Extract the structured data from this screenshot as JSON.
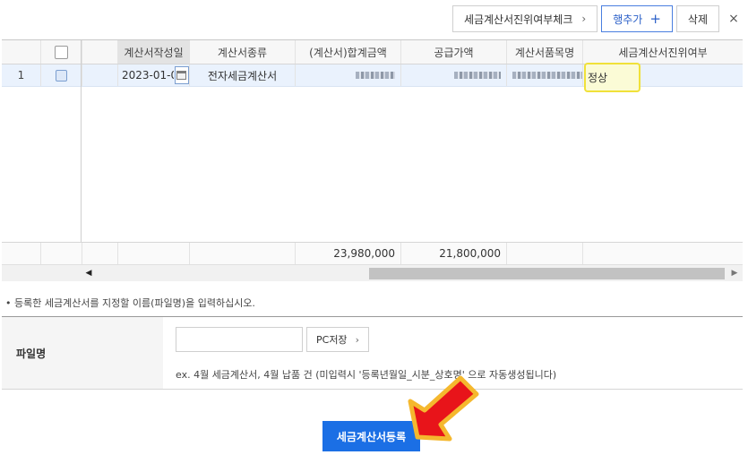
{
  "toolbar": {
    "verify_label": "세금계산서진위여부체크",
    "add_row_label": "행추가",
    "delete_label": "삭제",
    "close_symbol": "×"
  },
  "grid": {
    "columns": [
      "계산서작성일",
      "계산서종류",
      "(계산서)합계금액",
      "공급가액",
      "계산서품목명",
      "세금계산서진위여부"
    ],
    "rows": [
      {
        "num": "1",
        "date": "2023-01-06",
        "type": "전자세금계산서",
        "status": "정상"
      }
    ],
    "totals": {
      "total_amount": "23,980,000",
      "supply_amount": "21,800,000"
    }
  },
  "note": "• 등록한 세금계산서를 지정할 이름(파일명)을 입력하십시오.",
  "form": {
    "filename_label": "파일명",
    "filename_value": "",
    "pc_save_label": "PC저장",
    "hint": "ex. 4월 세금계산서, 4월 납품 건 (미입력시 '등록년월일_시분_상호명' 으로 자동생성됩니다)"
  },
  "submit_label": "세금계산서등록",
  "colors": {
    "accent": "#1b6fe5",
    "highlight_border": "#f0e13a",
    "arrow_red": "#e8141a",
    "arrow_gold": "#f5b82e"
  }
}
